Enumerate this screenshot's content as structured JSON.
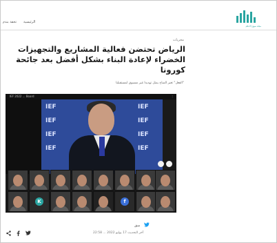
{
  "header": {
    "nav_items": [
      "الرئيسية",
      "تحقة بندم"
    ],
    "logo_caption": "مجلة سوق الاعلام"
  },
  "article": {
    "category": "مجريات",
    "title": "الرياض تحتضن فعالية المشاريع والتجهيزات الخضراء لإعادة البناء بشكل أفضل بعد جائحة كورونا",
    "subtitle": "\"الفعل\" تغير المناخ يمثل تهديدا غير مسبوق لمستقبلنا"
  },
  "video": {
    "top_left": "IEF 2022 ... Board",
    "top_right": "⋮",
    "banner_word": "IEF"
  },
  "participants": {
    "letter_tiles": [
      "K",
      "f"
    ]
  },
  "share": {
    "label": "سق",
    "date": "آخر التحديث 17 يوليو 2022 ... 22:58"
  },
  "social": {
    "icons": [
      "share-icon",
      "facebook-icon",
      "twitter-icon"
    ]
  },
  "colors": {
    "brand": "#2aa5a1",
    "video_bg": "#2e4b9a",
    "twitter": "#1da1f2"
  }
}
